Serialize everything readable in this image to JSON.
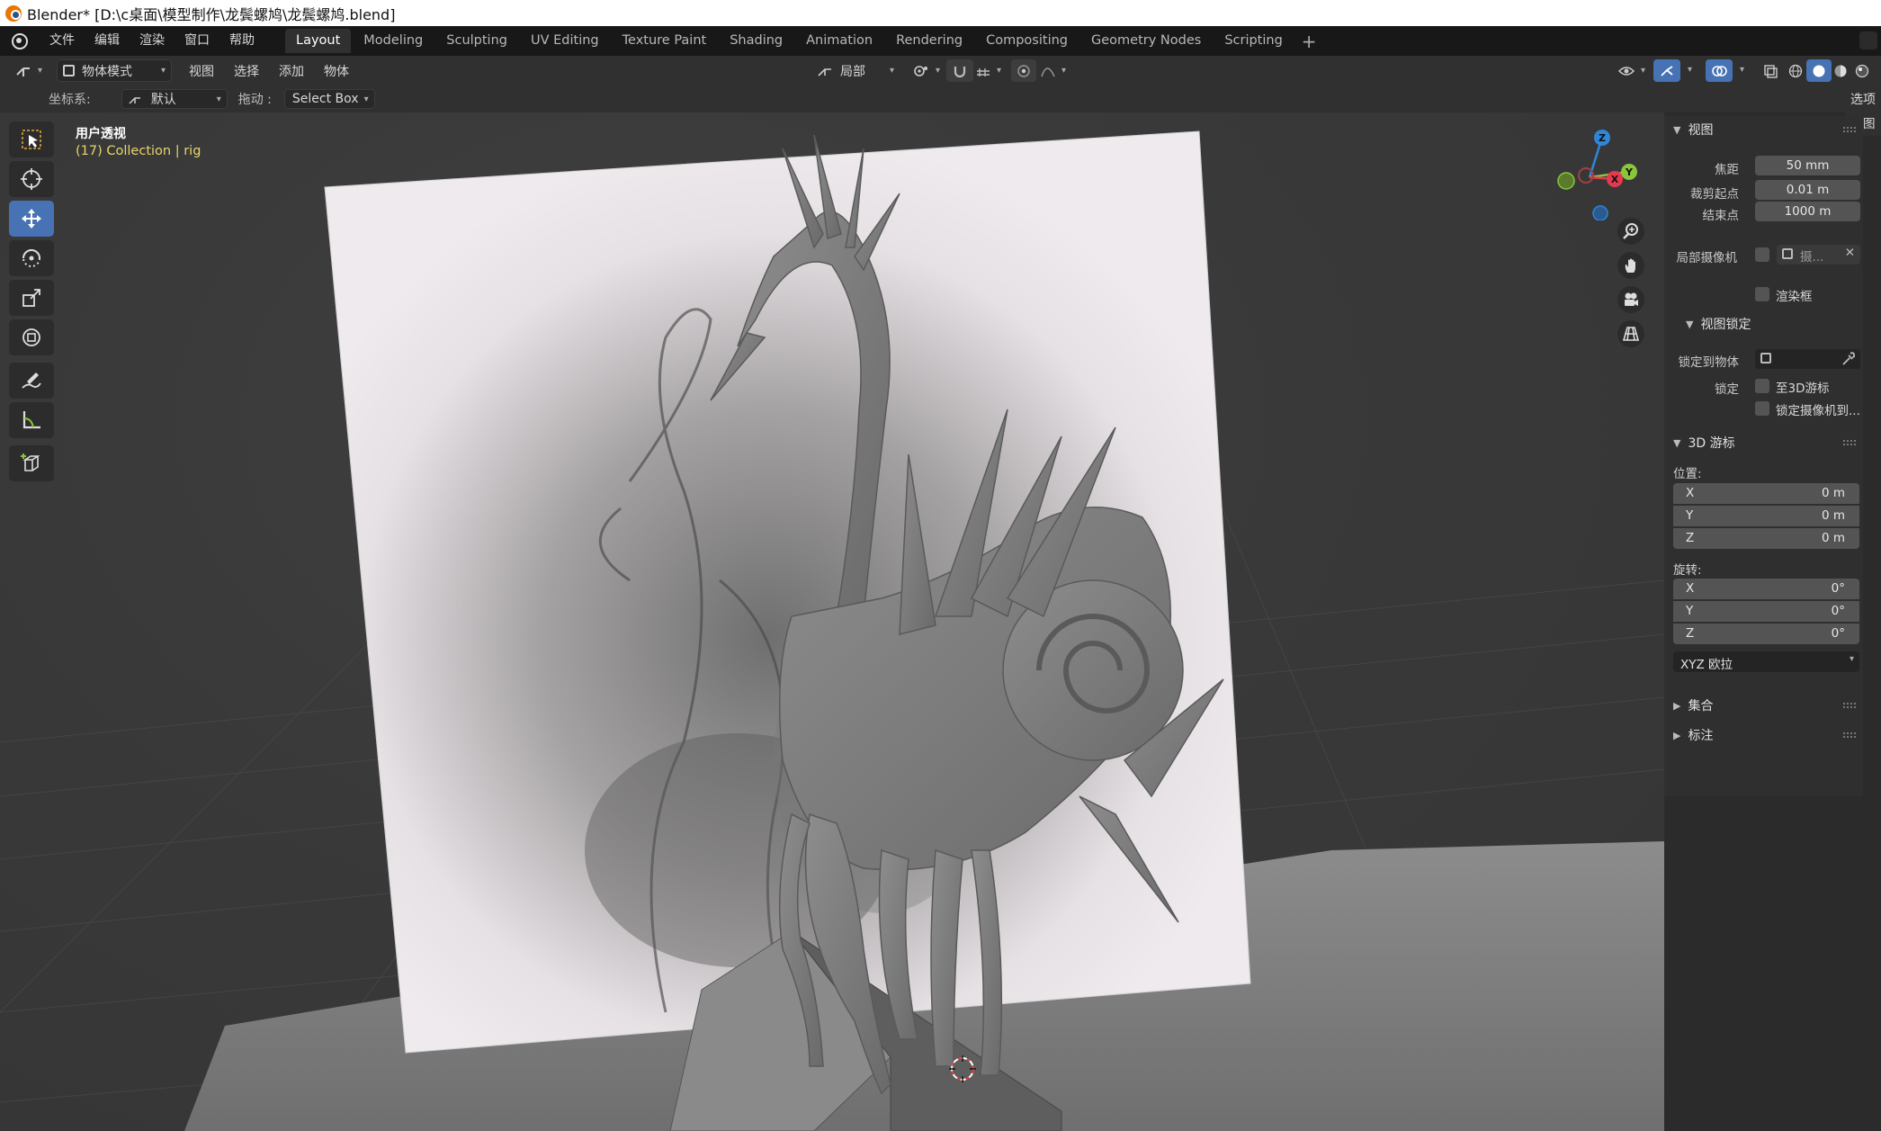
{
  "window": {
    "title": "Blender* [D:\\c桌面\\模型制作\\龙鬓螺鸠\\龙鬓螺鸠.blend]"
  },
  "menubar": {
    "items": [
      "文件",
      "编辑",
      "渲染",
      "窗口",
      "帮助"
    ]
  },
  "workspaces": {
    "tabs": [
      "Layout",
      "Modeling",
      "Sculpting",
      "UV Editing",
      "Texture Paint",
      "Shading",
      "Animation",
      "Rendering",
      "Compositing",
      "Geometry Nodes",
      "Scripting"
    ],
    "active": "Layout",
    "add": "+"
  },
  "header": {
    "mode": "物体模式",
    "menus": [
      "视图",
      "选择",
      "添加",
      "物体"
    ],
    "transform_orientation": "局部"
  },
  "tool_settings": {
    "orientation_label": "坐标系:",
    "orientation_value": "默认",
    "drag_label": "拖动 :",
    "drag_value": "Select Box",
    "options_tab": "选项"
  },
  "viewport": {
    "view_name": "用户透视",
    "collection_info": "(17) Collection | rig",
    "gizmo": {
      "x": "X",
      "y": "Y",
      "z": "Z"
    },
    "colors": {
      "x_axis": "#e5394f",
      "y_axis": "#8ac53a",
      "z_axis": "#2f86d9",
      "active_tool": "#4772b3",
      "collection_text": "#e8d56b"
    }
  },
  "toolbar": {
    "tools": [
      "select-box",
      "cursor",
      "move",
      "rotate",
      "scale",
      "transform",
      "annotate",
      "measure",
      "add-cube"
    ],
    "active": "move"
  },
  "npanel": {
    "view_panel": {
      "title": "视图",
      "focal_label": "焦距",
      "focal_value": "50 mm",
      "clip_start_label": "裁剪起点",
      "clip_start_value": "0.01 m",
      "clip_end_label": "结束点",
      "clip_end_value": "1000 m",
      "local_camera_label": "局部摄像机",
      "local_camera_value": "摄...",
      "render_region_label": "渲染框",
      "view_lock_title": "视图锁定",
      "lock_to_object_label": "锁定到物体",
      "lock_label": "锁定",
      "lock_to_cursor_label": "至3D游标",
      "lock_camera_label": "锁定摄像机到..."
    },
    "cursor_panel": {
      "title": "3D 游标",
      "location_label": "位置:",
      "location": [
        {
          "axis": "X",
          "value": "0 m"
        },
        {
          "axis": "Y",
          "value": "0 m"
        },
        {
          "axis": "Z",
          "value": "0 m"
        }
      ],
      "rotation_label": "旋转:",
      "rotation": [
        {
          "axis": "X",
          "value": "0°"
        },
        {
          "axis": "Y",
          "value": "0°"
        },
        {
          "axis": "Z",
          "value": "0°"
        }
      ],
      "rotation_mode": "XYZ 欧拉"
    },
    "collections_title": "集合",
    "annotations_title": "标注"
  }
}
